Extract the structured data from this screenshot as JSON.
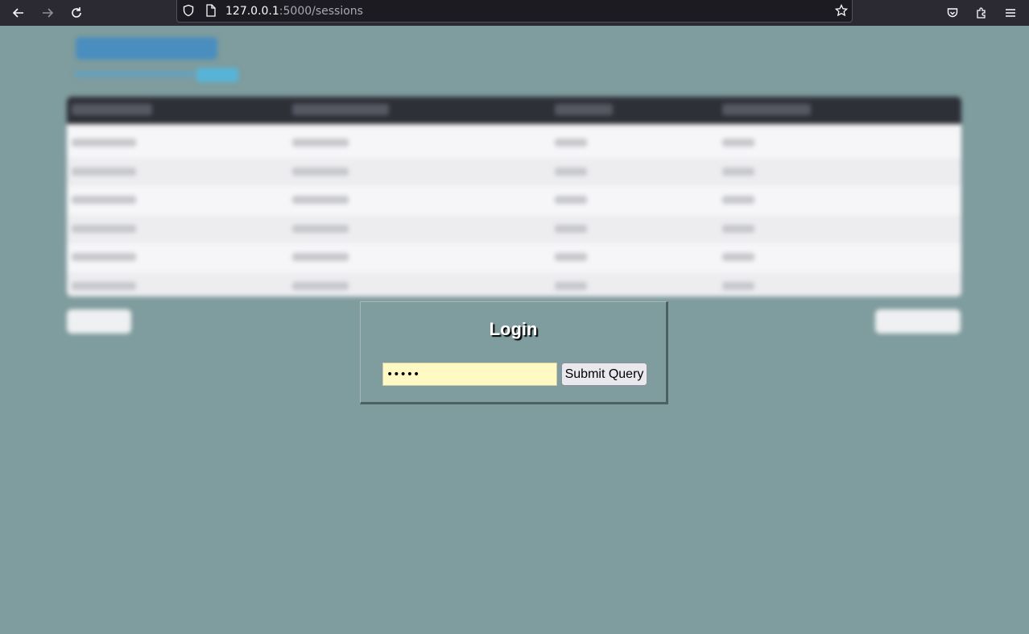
{
  "browser": {
    "url_host": "127.0.0.1",
    "url_rest": ":5000/sessions"
  },
  "modal": {
    "title": "Login",
    "password_value": "•••••",
    "submit_label": "Submit Query"
  }
}
